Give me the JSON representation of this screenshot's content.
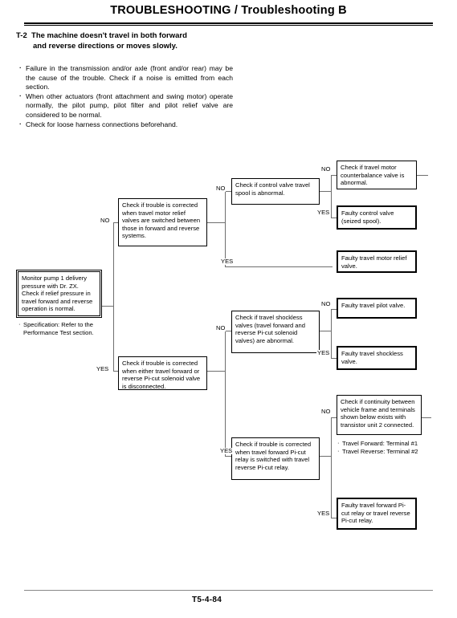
{
  "header": {
    "title": "TROUBLESHOOTING / Troubleshooting B"
  },
  "problem": {
    "code": "T-2",
    "line1": "The machine doesn't travel in both forward",
    "line2": "and reverse directions or moves slowly."
  },
  "notes": [
    "Failure in the transmission and/or axle (front and/or rear) may be the cause of the trouble. Check if a noise is emitted from each section.",
    "When other actuators (front attachment and swing motor) operate normally, the pilot pump, pilot filter and pilot relief valve are considered to be normal.",
    "Check for loose harness connections beforehand."
  ],
  "flow": {
    "start": {
      "text": "Monitor pump 1 delivery pressure with Dr. ZX. Check if relief pressure in travel forward and reverse operation is normal.",
      "spec": "Specification: Refer to the Performance Test section."
    },
    "nodes": {
      "check_relief_switched": "Check if trouble is corrected when travel motor relief valves are switched between those in forward and reverse systems.",
      "check_picut_disconnected": "Check if trouble is corrected when either travel forward or reverse Pi-cut solenoid valve is disconnected.",
      "check_control_valve_spool": "Check if control valve travel spool is abnormal.",
      "check_shockless_valves": "Check if travel shockless valves (travel forward and reverse Pi-cut solenoid valves) are abnormal.",
      "check_picut_relay_switched": "Check if trouble is corrected when travel forward Pi-cut relay is switched with travel reverse Pi-cut relay.",
      "check_counterbalance_valve": "Check if travel motor counterbalance valve is abnormal.",
      "check_continuity": "Check if continuity between vehicle frame and terminals shown below exists with transistor unit 2 connected.",
      "continuity_note_1": "Travel Forward: Terminal #1",
      "continuity_note_2": "Travel Reverse: Terminal #2"
    },
    "faults": {
      "control_valve": "Faulty control valve (seized spool).",
      "motor_relief": "Faulty travel motor relief valve.",
      "travel_pilot": "Faulty travel pilot valve.",
      "shockless": "Faulty travel shockless valve.",
      "picut_relay": "Faulty travel forward Pi-cut relay or travel reverse Pi-cut relay."
    },
    "labels": {
      "no": "NO",
      "yes": "YES"
    }
  },
  "footer": {
    "page": "T5-4-84"
  }
}
